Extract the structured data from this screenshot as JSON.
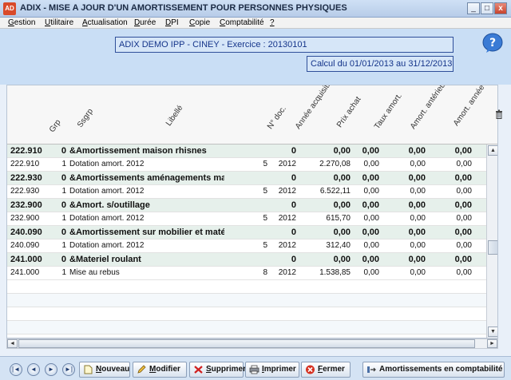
{
  "window": {
    "title": "ADIX - MISE A JOUR D'UN AMORTISSEMENT POUR PERSONNES PHYSIQUES",
    "icon_label": "AD",
    "minimize": "_",
    "maximize": "□",
    "close": "x"
  },
  "menu": [
    {
      "first": "G",
      "rest": "estion"
    },
    {
      "first": "U",
      "rest": "tilitaire"
    },
    {
      "first": "A",
      "rest": "ctualisation"
    },
    {
      "first": "D",
      "rest": "urée"
    },
    {
      "first": "D",
      "rest": "PI"
    },
    {
      "first": "C",
      "rest": "opie"
    },
    {
      "first": "C",
      "rest": "omptabilité"
    },
    {
      "first": "?",
      "rest": ""
    }
  ],
  "header": {
    "company_info": "ADIX DEMO IPP  - CINEY - Exercice : 20130101",
    "period": "Calcul du 01/01/2013 au  31/12/2013",
    "help": "?"
  },
  "columns": [
    "Grp",
    "Ssgrp",
    "Libellé",
    "N° doc.",
    "Année acquisition",
    "Prix achat",
    "Taux amort.",
    "Amort. antérieur",
    "Amort. année"
  ],
  "rows": [
    {
      "kind": "group",
      "code": "222.910",
      "ssgrp": "0",
      "label": "&Amortissement maison rhisnes",
      "doc": "",
      "year": "0",
      "price": "0,00",
      "rate": "0,00",
      "prior": "0,00",
      "annual": "0,00"
    },
    {
      "kind": "detail",
      "code": "222.910",
      "ssgrp": "1",
      "label": "Dotation amort. 2012",
      "doc": "5",
      "year": "2012",
      "price": "2.270,08",
      "rate": "0,00",
      "prior": "0,00",
      "annual": "0,00"
    },
    {
      "kind": "group",
      "code": "222.930",
      "ssgrp": "0",
      "label": "&Amortissements aménagements maison",
      "doc": "",
      "year": "0",
      "price": "0,00",
      "rate": "0,00",
      "prior": "0,00",
      "annual": "0,00"
    },
    {
      "kind": "detail",
      "code": "222.930",
      "ssgrp": "1",
      "label": "Dotation amort. 2012",
      "doc": "5",
      "year": "2012",
      "price": "6.522,11",
      "rate": "0,00",
      "prior": "0,00",
      "annual": "0,00"
    },
    {
      "kind": "group",
      "code": "232.900",
      "ssgrp": "0",
      "label": "&Amort. s/outillage",
      "doc": "",
      "year": "0",
      "price": "0,00",
      "rate": "0,00",
      "prior": "0,00",
      "annual": "0,00"
    },
    {
      "kind": "detail",
      "code": "232.900",
      "ssgrp": "1",
      "label": "Dotation amort. 2012",
      "doc": "5",
      "year": "2012",
      "price": "615,70",
      "rate": "0,00",
      "prior": "0,00",
      "annual": "0,00"
    },
    {
      "kind": "group",
      "code": "240.090",
      "ssgrp": "0",
      "label": "&Amortissement sur mobilier et matériel",
      "doc": "",
      "year": "0",
      "price": "0,00",
      "rate": "0,00",
      "prior": "0,00",
      "annual": "0,00"
    },
    {
      "kind": "detail",
      "code": "240.090",
      "ssgrp": "1",
      "label": "Dotation amort. 2012",
      "doc": "5",
      "year": "2012",
      "price": "312,40",
      "rate": "0,00",
      "prior": "0,00",
      "annual": "0,00"
    },
    {
      "kind": "group",
      "code": "241.000",
      "ssgrp": "0",
      "label": "&Materiel roulant",
      "doc": "",
      "year": "0",
      "price": "0,00",
      "rate": "0,00",
      "prior": "0,00",
      "annual": "0,00"
    },
    {
      "kind": "detail",
      "code": "241.000",
      "ssgrp": "1",
      "label": "Mise au rebus",
      "doc": "8",
      "year": "2012",
      "price": "1.538,85",
      "rate": "0,00",
      "prior": "0,00",
      "annual": "0,00"
    }
  ],
  "empty_rows": 7,
  "scroll": {
    "up": "▲",
    "down": "▼",
    "left": "◄",
    "right": "►"
  },
  "footer": {
    "nav": [
      "|◄",
      "◄",
      "►",
      "►|"
    ],
    "buttons": [
      {
        "key": "nouveau",
        "first": "N",
        "rest": "ouveau"
      },
      {
        "key": "modifier",
        "first": "M",
        "rest": "odifier"
      },
      {
        "key": "supprimer",
        "first": "S",
        "rest": "upprimer"
      },
      {
        "key": "imprimer",
        "first": "I",
        "rest": "mprimer"
      },
      {
        "key": "fermer",
        "first": "F",
        "rest": "ermer"
      }
    ],
    "compta_button": "Amortissements en comptabilité"
  },
  "colors": {
    "accent": "#14348a",
    "group_row": "#e6f0eb",
    "header_bg": "#c9def5"
  }
}
